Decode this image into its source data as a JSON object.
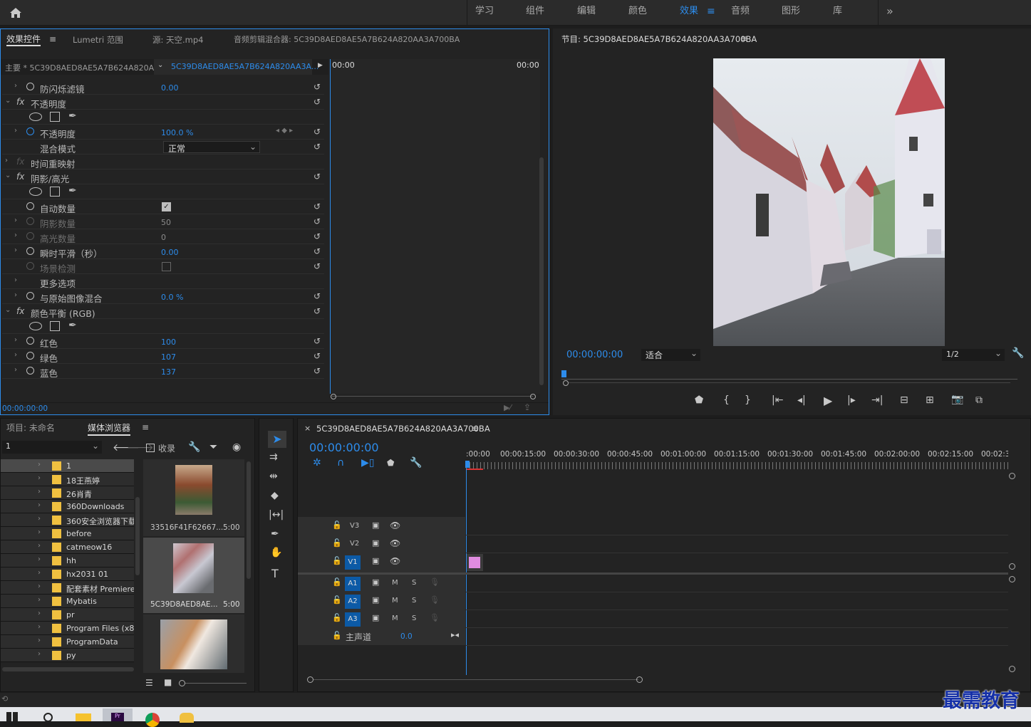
{
  "workspace": {
    "items": [
      "学习",
      "组件",
      "编辑",
      "颜色",
      "效果",
      "音频",
      "图形",
      "库"
    ],
    "active": "效果",
    "more": "»"
  },
  "effect_controls": {
    "tabs": [
      "效果控件",
      "Lumetri 范围",
      "源: 天空.mp4",
      "音频剪辑混合器: 5C39D8AED8AE5A7B624A820AA3A700BA"
    ],
    "master": "主要 * 5C39D8AED8AE5A7B624A820A...",
    "clip": "5C39D8AED8AE5A7B624A820AA3A...",
    "timecode_start": "00:00",
    "timecode_end": "00:00",
    "current_time": "00:00:00:00",
    "rows": [
      {
        "label": "防闪烁滤镜",
        "value": "0.00",
        "type": "prop"
      },
      {
        "label": "不透明度",
        "type": "section"
      },
      {
        "label": "不透明度",
        "value": "100.0 %",
        "type": "prop"
      },
      {
        "label": "混合模式",
        "value": "正常",
        "type": "select"
      },
      {
        "label": "时间重映射",
        "type": "section-off"
      },
      {
        "label": "阴影/高光",
        "type": "section"
      },
      {
        "label": "自动数量",
        "type": "check"
      },
      {
        "label": "阴影数量",
        "value": "50",
        "type": "prop-gray"
      },
      {
        "label": "高光数量",
        "value": "0",
        "type": "prop-gray"
      },
      {
        "label": "瞬时平滑（秒）",
        "value": "0.00",
        "type": "prop"
      },
      {
        "label": "场景检测",
        "type": "check-off"
      },
      {
        "label": "更多选项",
        "type": "more"
      },
      {
        "label": "与原始图像混合",
        "value": "0.0 %",
        "type": "prop"
      },
      {
        "label": "颜色平衡 (RGB)",
        "type": "section"
      },
      {
        "label": "红色",
        "value": "100",
        "type": "prop"
      },
      {
        "label": "绿色",
        "value": "107",
        "type": "prop"
      },
      {
        "label": "蓝色",
        "value": "137",
        "type": "prop"
      }
    ]
  },
  "program": {
    "title": "节目: 5C39D8AED8AE5A7B624A820AA3A700BA",
    "timecode": "00:00:00:00",
    "fit": "适合",
    "resolution": "1/2"
  },
  "project": {
    "tabs": [
      "项目: 未命名",
      "媒体浏览器"
    ],
    "path_value": "1",
    "ingest": "收录",
    "folders": [
      "1",
      "18王燕婷",
      "26肖青",
      "360Downloads",
      "360安全浏览器下载",
      "before",
      "catmeow16",
      "hh",
      "hx2031 01",
      "配套素材 Premiere",
      "Mybatis",
      "pr",
      "Program Files (x86)",
      "ProgramData",
      "py"
    ],
    "thumbs": [
      {
        "name": "33516F41F62667...",
        "dur": "5:00"
      },
      {
        "name": "5C39D8AED8AE...",
        "dur": "5:00"
      },
      {
        "name": "",
        "dur": ""
      }
    ]
  },
  "timeline": {
    "title": "5C39D8AED8AE5A7B624A820AA3A700BA",
    "timecode": "00:00:00:00",
    "ruler": [
      ":00:00",
      "00:00:15:00",
      "00:00:30:00",
      "00:00:45:00",
      "00:01:00:00",
      "00:01:15:00",
      "00:01:30:00",
      "00:01:45:00",
      "00:02:00:00",
      "00:02:15:00",
      "00:02:3("
    ],
    "video_tracks": [
      "V3",
      "V2",
      "V1"
    ],
    "audio_tracks": [
      "A1",
      "A2",
      "A3"
    ],
    "master_label": "主声道",
    "master_value": "0.0",
    "m": "M",
    "s": "S"
  },
  "watermark": "最需教育",
  "colors": {
    "accent": "#2d8ceb",
    "folder": "#f0c040",
    "clip": "#e08ce0"
  }
}
